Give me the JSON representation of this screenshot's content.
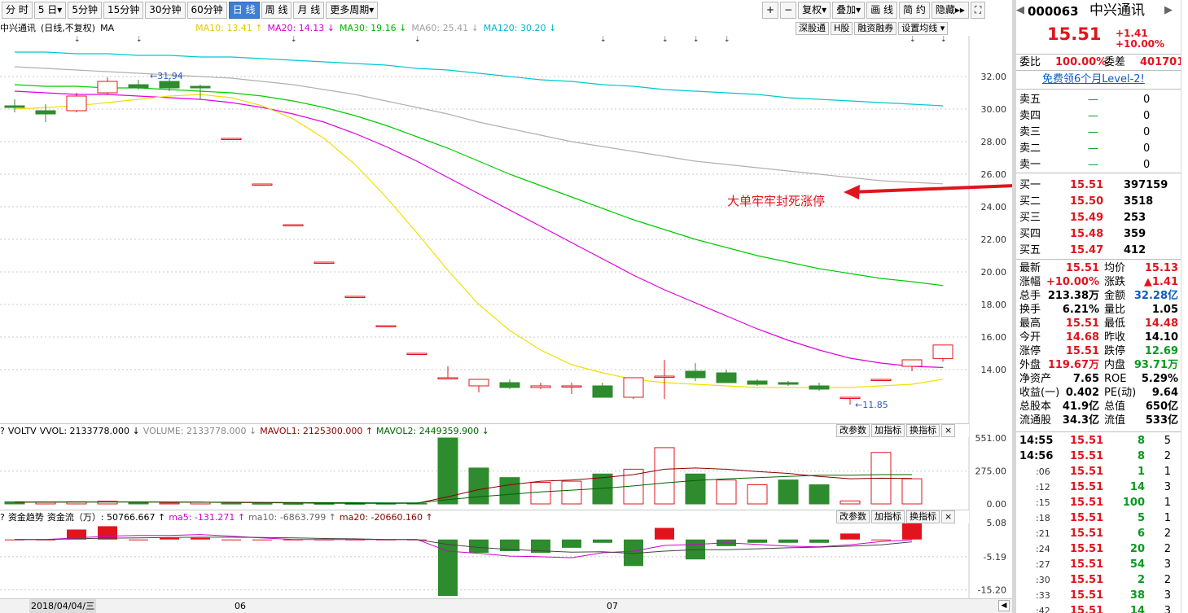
{
  "toolbar": {
    "periods": [
      "分 时",
      "5 日▾",
      "5分钟",
      "15分钟",
      "30分钟",
      "60分钟",
      "日 线",
      "周 线",
      "月 线",
      "更多周期▾"
    ],
    "active_period": "日 线",
    "right_buttons": [
      "+",
      "−",
      "复权▾",
      "叠加▾",
      "画 线",
      "简 约",
      "隐藏▸▸",
      "⛶"
    ]
  },
  "info": {
    "name": "中兴通讯",
    "mode": "(日线,不复权)",
    "indicator": "MA",
    "ma10": "MA10: 13.41 ↑",
    "ma20": "MA20: 14.13 ↓",
    "ma30": "MA30: 19.16 ↓",
    "ma60": "MA60: 25.41 ↓",
    "ma120": "MA120: 30.20 ↓",
    "buttons": [
      "深股通",
      "H股",
      "融资融券",
      "设置均线 ▾"
    ]
  },
  "annotation": "大单牢牢封死涨停",
  "price_axis": [
    "32.00",
    "30.00",
    "28.00",
    "26.00",
    "24.00",
    "22.00",
    "20.00",
    "18.00",
    "16.00",
    "14.00"
  ],
  "high_label": "31.94",
  "low_label": "11.85",
  "volume": {
    "header": [
      "VOLTV",
      "VVOL: 2133778.000 ↓",
      "VOLUME: 2133778.000 ↓",
      "MAVOL1: 2125300.000 ↑",
      "MAVOL2: 2449359.900 ↓"
    ],
    "axis": [
      "551.00",
      "275.00",
      "0.00"
    ]
  },
  "money": {
    "header": [
      "资金趋势",
      "资金流（万）: 50766.667 ↑",
      "ma5: -131.271 ↑",
      "ma10: -6863.799 ↑",
      "ma20: -20660.160 ↑"
    ],
    "axis": [
      "5.08",
      "-5.19",
      "-15.20"
    ]
  },
  "panel_buttons": [
    "改参数",
    "加指标",
    "换指标",
    "×"
  ],
  "xaxis": {
    "date": "2018/04/04/三",
    "m06": "06",
    "m07": "07"
  },
  "chart_data": {
    "type": "candlestick",
    "title": "中兴通讯 (日线,不复权)",
    "candles": [
      {
        "o": 30.2,
        "h": 30.6,
        "l": 29.8,
        "c": 30.1
      },
      {
        "o": 29.9,
        "h": 30.3,
        "l": 29.2,
        "c": 29.7
      },
      {
        "o": 29.9,
        "h": 31.0,
        "l": 29.8,
        "c": 30.8
      },
      {
        "o": 31.0,
        "h": 31.94,
        "l": 30.9,
        "c": 31.7
      },
      {
        "o": 31.5,
        "h": 31.8,
        "l": 31.2,
        "c": 31.3
      },
      {
        "o": 31.7,
        "h": 31.9,
        "l": 31.1,
        "c": 31.3
      },
      {
        "o": 31.4,
        "h": 31.5,
        "l": 30.6,
        "c": 31.3
      },
      {
        "o": 28.2,
        "h": 28.2,
        "l": 28.2,
        "c": 28.2
      },
      {
        "o": 25.4,
        "h": 25.4,
        "l": 25.4,
        "c": 25.4
      },
      {
        "o": 22.9,
        "h": 22.9,
        "l": 22.9,
        "c": 22.9
      },
      {
        "o": 20.6,
        "h": 20.6,
        "l": 20.6,
        "c": 20.6
      },
      {
        "o": 18.5,
        "h": 18.5,
        "l": 18.5,
        "c": 18.5
      },
      {
        "o": 16.7,
        "h": 16.7,
        "l": 16.7,
        "c": 16.7
      },
      {
        "o": 15.0,
        "h": 15.0,
        "l": 15.0,
        "c": 15.0
      },
      {
        "o": 13.5,
        "h": 14.2,
        "l": 13.5,
        "c": 13.5
      },
      {
        "o": 13.0,
        "h": 13.4,
        "l": 12.6,
        "c": 13.4
      },
      {
        "o": 13.2,
        "h": 13.4,
        "l": 12.8,
        "c": 12.9
      },
      {
        "o": 12.9,
        "h": 13.2,
        "l": 12.8,
        "c": 13.0
      },
      {
        "o": 13.0,
        "h": 13.2,
        "l": 12.5,
        "c": 13.0
      },
      {
        "o": 13.0,
        "h": 13.2,
        "l": 12.4,
        "c": 12.3
      },
      {
        "o": 12.3,
        "h": 13.5,
        "l": 12.2,
        "c": 13.5
      },
      {
        "o": 13.6,
        "h": 14.6,
        "l": 12.2,
        "c": 13.6
      },
      {
        "o": 13.9,
        "h": 14.4,
        "l": 13.3,
        "c": 13.5
      },
      {
        "o": 13.8,
        "h": 14.0,
        "l": 13.3,
        "c": 13.2
      },
      {
        "o": 13.3,
        "h": 13.4,
        "l": 13.0,
        "c": 13.1
      },
      {
        "o": 13.2,
        "h": 13.3,
        "l": 13.0,
        "c": 13.1
      },
      {
        "o": 13.0,
        "h": 13.2,
        "l": 12.7,
        "c": 12.8
      },
      {
        "o": 12.3,
        "h": 12.3,
        "l": 11.85,
        "c": 12.3
      },
      {
        "o": 13.4,
        "h": 13.4,
        "l": 13.4,
        "c": 13.4
      },
      {
        "o": 14.2,
        "h": 14.3,
        "l": 13.9,
        "c": 14.6
      },
      {
        "o": 14.68,
        "h": 15.51,
        "l": 14.48,
        "c": 15.51
      }
    ],
    "ma10": [
      30.0,
      30.1,
      30.2,
      30.4,
      30.6,
      30.8,
      30.9,
      30.7,
      30.2,
      29.4,
      28.2,
      26.6,
      24.6,
      22.4,
      20.1,
      18.0,
      16.4,
      15.2,
      14.3,
      13.8,
      13.4,
      13.2,
      13.1,
      13.0,
      12.9,
      12.9,
      12.9,
      12.9,
      13.0,
      13.1,
      13.41
    ],
    "ma20": [
      31.1,
      31.0,
      30.9,
      30.9,
      30.8,
      30.7,
      30.6,
      30.4,
      30.1,
      29.7,
      29.2,
      28.5,
      27.7,
      26.8,
      25.8,
      24.8,
      23.8,
      22.8,
      21.8,
      20.8,
      19.8,
      18.9,
      18.1,
      17.3,
      16.5,
      15.8,
      15.2,
      14.7,
      14.4,
      14.2,
      14.13
    ],
    "ma30": [
      31.5,
      31.4,
      31.4,
      31.3,
      31.3,
      31.2,
      31.1,
      31.0,
      30.8,
      30.5,
      30.1,
      29.6,
      29.0,
      28.3,
      27.6,
      26.8,
      26.0,
      25.3,
      24.6,
      23.9,
      23.2,
      22.6,
      22.0,
      21.5,
      21.0,
      20.6,
      20.2,
      19.9,
      19.6,
      19.4,
      19.16
    ],
    "ma60": [
      32.6,
      32.5,
      32.4,
      32.3,
      32.2,
      32.1,
      32.0,
      31.9,
      31.7,
      31.5,
      31.2,
      30.9,
      30.5,
      30.1,
      29.7,
      29.2,
      28.8,
      28.4,
      28.0,
      27.7,
      27.4,
      27.1,
      26.8,
      26.6,
      26.4,
      26.2,
      26.0,
      25.8,
      25.6,
      25.5,
      25.41
    ],
    "ma120": [
      33.5,
      33.5,
      33.4,
      33.4,
      33.3,
      33.3,
      33.2,
      33.2,
      33.1,
      33.0,
      32.9,
      32.8,
      32.7,
      32.5,
      32.4,
      32.2,
      32.0,
      31.8,
      31.7,
      31.5,
      31.4,
      31.2,
      31.1,
      31.0,
      30.9,
      30.7,
      30.6,
      30.5,
      30.4,
      30.3,
      30.2
    ],
    "volume": [
      {
        "v": 18,
        "up": false
      },
      {
        "v": 16,
        "up": true
      },
      {
        "v": 18,
        "up": true
      },
      {
        "v": 22,
        "up": true
      },
      {
        "v": 15,
        "up": false
      },
      {
        "v": 8,
        "up": true
      },
      {
        "v": 14,
        "up": true
      },
      {
        "v": 6,
        "up": false
      },
      {
        "v": 5,
        "up": false
      },
      {
        "v": 4,
        "up": false
      },
      {
        "v": 4,
        "up": false
      },
      {
        "v": 4,
        "up": false
      },
      {
        "v": 5,
        "up": false
      },
      {
        "v": 6,
        "up": false
      },
      {
        "v": 551,
        "up": false
      },
      {
        "v": 300,
        "up": false
      },
      {
        "v": 220,
        "up": false
      },
      {
        "v": 180,
        "up": true
      },
      {
        "v": 190,
        "up": true
      },
      {
        "v": 250,
        "up": false
      },
      {
        "v": 290,
        "up": true
      },
      {
        "v": 470,
        "up": true
      },
      {
        "v": 250,
        "up": false
      },
      {
        "v": 200,
        "up": true
      },
      {
        "v": 160,
        "up": true
      },
      {
        "v": 200,
        "up": false
      },
      {
        "v": 160,
        "up": false
      },
      {
        "v": 25,
        "up": true
      },
      {
        "v": 430,
        "up": true
      },
      {
        "v": 210,
        "up": true
      }
    ],
    "mavol1": [
      14,
      14,
      15,
      16,
      16,
      15,
      14,
      12,
      10,
      8,
      6,
      5,
      5,
      5,
      60,
      120,
      160,
      190,
      200,
      220,
      245,
      290,
      300,
      290,
      270,
      255,
      230,
      210,
      215,
      212
    ],
    "mavol2": [
      16,
      16,
      16,
      16,
      16,
      15,
      15,
      14,
      13,
      12,
      11,
      10,
      9,
      9,
      36,
      60,
      80,
      100,
      115,
      130,
      150,
      175,
      195,
      210,
      220,
      230,
      240,
      240,
      245,
      245
    ],
    "moneyflow": [
      0,
      0,
      3,
      4,
      0,
      0.5,
      0.5,
      0,
      0,
      0,
      0,
      0,
      0,
      0,
      -17,
      -4,
      -3.5,
      -4,
      -2.5,
      -1,
      -8,
      3.5,
      -6,
      -2,
      -1,
      -1,
      -1,
      1.8,
      0,
      5.08
    ],
    "money_ma5": [
      0,
      0,
      0.5,
      1,
      1.2,
      1.2,
      1.5,
      1,
      0.5,
      0,
      0,
      0,
      0,
      0,
      -3.5,
      -4.2,
      -5,
      -5.2,
      -5.5,
      -4,
      -3.5,
      -1.8,
      -1.5,
      -1,
      -1.5,
      -2,
      -2.2,
      -1.6,
      -0.6,
      -0.1
    ],
    "money_ma10": [
      0,
      0,
      0.2,
      0.4,
      0.5,
      0.6,
      0.7,
      0.7,
      0.6,
      0.5,
      0.3,
      0.2,
      0,
      0,
      -1.5,
      -2.4,
      -3,
      -3.4,
      -3.8,
      -3.7,
      -4.2,
      -3.5,
      -3.1,
      -3.1,
      -2.8,
      -2.5,
      -2.3,
      -2,
      -1.6,
      -0.7
    ],
    "price_ylim": [
      11.0,
      34.5
    ]
  },
  "quote": {
    "code": "000063",
    "name": "中兴通讯",
    "price": "15.51",
    "change": "+1.41",
    "pct": "+10.00%",
    "weibi_label": "委比",
    "weibi": "100.00%",
    "weicha_label": "委差",
    "weicha": "401701",
    "promo": "免费领6个月Level-2!",
    "sells": [
      {
        "label": "卖五",
        "price": "—",
        "vol": "0"
      },
      {
        "label": "卖四",
        "price": "—",
        "vol": "0"
      },
      {
        "label": "卖三",
        "price": "—",
        "vol": "0"
      },
      {
        "label": "卖二",
        "price": "—",
        "vol": "0"
      },
      {
        "label": "卖一",
        "price": "—",
        "vol": "0"
      }
    ],
    "buys": [
      {
        "label": "买一",
        "price": "15.51",
        "vol": "397159"
      },
      {
        "label": "买二",
        "price": "15.50",
        "vol": "3518"
      },
      {
        "label": "买三",
        "price": "15.49",
        "vol": "253"
      },
      {
        "label": "买四",
        "price": "15.48",
        "vol": "359"
      },
      {
        "label": "买五",
        "price": "15.47",
        "vol": "412"
      }
    ],
    "stats": [
      {
        "l1": "最新",
        "v1": "15.51",
        "c1": "red",
        "l2": "均价",
        "v2": "15.13",
        "c2": "red"
      },
      {
        "l1": "涨幅",
        "v1": "+10.00%",
        "c1": "red",
        "l2": "涨跌",
        "v2": "▲1.41",
        "c2": "red"
      },
      {
        "l1": "总手",
        "v1": "213.38万",
        "c1": "black",
        "l2": "金额",
        "v2": "32.28亿",
        "c2": "blue"
      },
      {
        "l1": "换手",
        "v1": "6.21%",
        "c1": "black",
        "l2": "量比",
        "v2": "1.05",
        "c2": "black"
      },
      {
        "l1": "最高",
        "v1": "15.51",
        "c1": "red",
        "l2": "最低",
        "v2": "14.48",
        "c2": "red"
      },
      {
        "l1": "今开",
        "v1": "14.68",
        "c1": "red",
        "l2": "昨收",
        "v2": "14.10",
        "c2": "black"
      },
      {
        "l1": "涨停",
        "v1": "15.51",
        "c1": "red",
        "l2": "跌停",
        "v2": "12.69",
        "c2": "green"
      },
      {
        "l1": "外盘",
        "v1": "119.67万",
        "c1": "red",
        "l2": "内盘",
        "v2": "93.71万",
        "c2": "green"
      },
      {
        "l1": "净资产",
        "v1": "7.65",
        "c1": "black",
        "l2": "ROE",
        "v2": "5.29%",
        "c2": "black"
      },
      {
        "l1": "收益(一)",
        "v1": "0.402",
        "c1": "black",
        "l2": "PE(动)",
        "v2": "9.64",
        "c2": "black"
      },
      {
        "l1": "总股本",
        "v1": "41.9亿",
        "c1": "black",
        "l2": "总值",
        "v2": "650亿",
        "c2": "black"
      },
      {
        "l1": "流通股",
        "v1": "34.3亿",
        "c1": "black",
        "l2": "流值",
        "v2": "533亿",
        "c2": "black"
      }
    ],
    "ticks": [
      {
        "t": "14:55",
        "p": "15.51",
        "v": "8",
        "n": "5"
      },
      {
        "t": "14:56",
        "p": "15.51",
        "v": "8",
        "n": "2"
      },
      {
        "t": ":06",
        "p": "15.51",
        "v": "1",
        "n": "1"
      },
      {
        "t": ":12",
        "p": "15.51",
        "v": "14",
        "n": "3"
      },
      {
        "t": ":15",
        "p": "15.51",
        "v": "100",
        "n": "1"
      },
      {
        "t": ":18",
        "p": "15.51",
        "v": "5",
        "n": "1"
      },
      {
        "t": ":21",
        "p": "15.51",
        "v": "6",
        "n": "2"
      },
      {
        "t": ":24",
        "p": "15.51",
        "v": "20",
        "n": "2"
      },
      {
        "t": ":27",
        "p": "15.51",
        "v": "54",
        "n": "3"
      },
      {
        "t": ":30",
        "p": "15.51",
        "v": "2",
        "n": "2"
      },
      {
        "t": ":33",
        "p": "15.51",
        "v": "38",
        "n": "3"
      },
      {
        "t": ":42",
        "p": "15.51",
        "v": "14",
        "n": "3"
      }
    ]
  },
  "colors": {
    "up": "#e1141e",
    "down": "#2e8b2e",
    "ma10": "#f0e000",
    "ma20": "#e000e0",
    "ma30": "#00cc00",
    "ma60": "#b0b0b0",
    "ma120": "#00c8d0",
    "annotation": "#e1141e"
  }
}
